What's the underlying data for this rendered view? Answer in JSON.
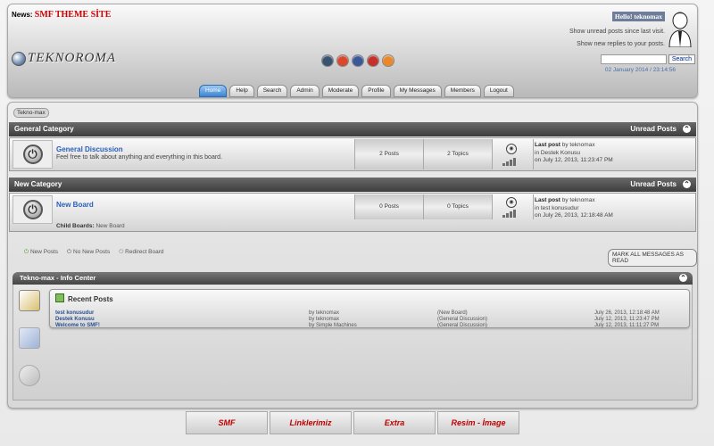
{
  "header": {
    "news_label": "News:",
    "news_text": "SMF THEME SİTE",
    "logo_text": "TEKNOROMA",
    "hello": "Hello! teknomax",
    "unread_link": "Show unread posts since last visit.",
    "replies_link": "Show new replies to your posts.",
    "search_button": "Search",
    "date": "02 January 2014 / 23:14:56",
    "social_icons": [
      "tumblr-icon",
      "google-plus-icon",
      "facebook-icon",
      "youtube-icon",
      "rss-icon"
    ],
    "social_colors": [
      "#3a5470",
      "#d9482d",
      "#3b5998",
      "#c4302b",
      "#e9892b"
    ]
  },
  "menu": [
    {
      "label": "Home",
      "active": true
    },
    {
      "label": "Help"
    },
    {
      "label": "Search"
    },
    {
      "label": "Admin"
    },
    {
      "label": "Moderate"
    },
    {
      "label": "Profile"
    },
    {
      "label": "My Messages"
    },
    {
      "label": "Members"
    },
    {
      "label": "Logout"
    }
  ],
  "breadcrumb": "Tekno-max",
  "categories": [
    {
      "name": "General Category",
      "unread": "Unread Posts",
      "board": {
        "name": "General Discussion",
        "desc": "Feel free to talk about anything and everything in this board.",
        "posts": "2 Posts",
        "topics": "2 Topics",
        "lastpost_label": "Last post",
        "lastpost_by": "by teknomax",
        "lastpost_in": "in Destek Konusu",
        "lastpost_on": "on July 12, 2013, 11:23:47 PM"
      }
    },
    {
      "name": "New Category",
      "unread": "Unread Posts",
      "board": {
        "name": "New Board",
        "desc": "",
        "posts": "0 Posts",
        "topics": "0 Topics",
        "lastpost_label": "Last post",
        "lastpost_by": "by teknomax",
        "lastpost_in": "in test konusudur",
        "lastpost_on": "on July 26, 2013, 12:18:48 AM",
        "child_label": "Child Boards:",
        "child_value": "New Board"
      }
    }
  ],
  "legend": [
    "New Posts",
    "No New Posts",
    "Redirect Board"
  ],
  "mark_all": "MARK ALL MESSAGES AS READ",
  "info_center": {
    "title": "Tekno-max - Info Center",
    "recent_title": "Recent Posts",
    "rows": [
      {
        "subject": "test konusudur",
        "poster": "by teknomax",
        "board": "(New Board)",
        "date": "July 26, 2013, 12:18:48 AM"
      },
      {
        "subject": "Destek Konusu",
        "poster": "by teknomax",
        "board": "(General Discussion)",
        "date": "July 12, 2013, 11:23:47 PM"
      },
      {
        "subject": "Welcome to SMF!",
        "poster": "by Simple Machines",
        "board": "(General Discussion)",
        "date": "July 12, 2013, 11:11:27 PM"
      }
    ]
  },
  "footer_tabs": [
    "SMF",
    "Linklerimiz",
    "Extra",
    "Resim - İmage"
  ]
}
